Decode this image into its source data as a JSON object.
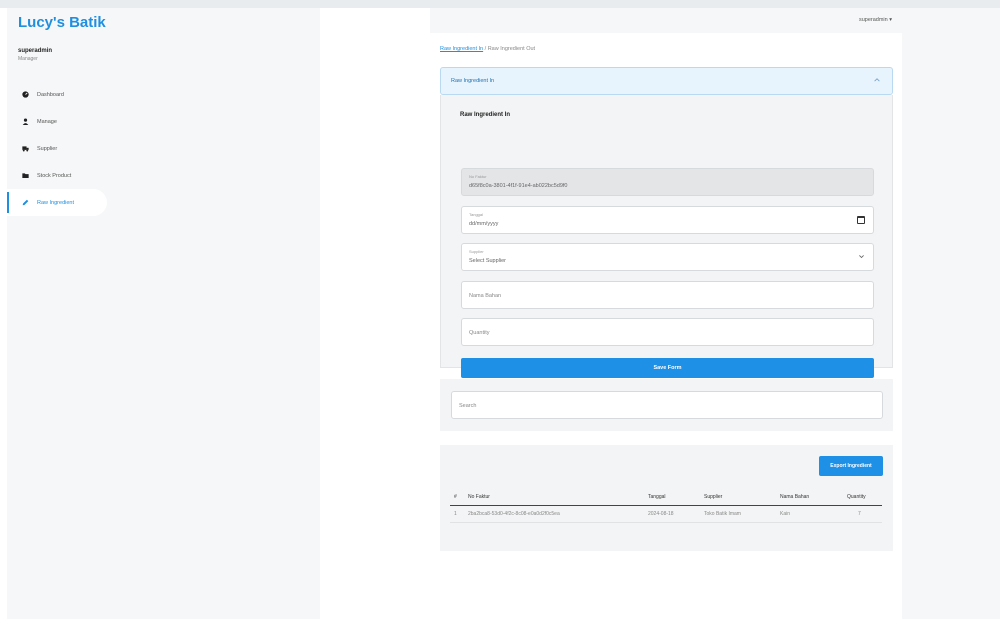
{
  "app": {
    "brand": "Lucy's Batik"
  },
  "user": {
    "name": "superadmin",
    "role": "Manager",
    "menu_label": "superadmin ▾"
  },
  "sidebar": {
    "items": [
      {
        "label": "Dashboard",
        "icon": "dashboard-icon"
      },
      {
        "label": "Manage",
        "icon": "user-icon"
      },
      {
        "label": "Supplier",
        "icon": "truck-icon"
      },
      {
        "label": "Stock Product",
        "icon": "folder-icon"
      },
      {
        "label": "Raw Ingredient",
        "icon": "edit-icon",
        "active": true
      }
    ]
  },
  "breadcrumb": {
    "link": "Raw Ingredient In",
    "separator": "/",
    "current": "Raw Ingredient Out"
  },
  "accordion": {
    "title": "Raw Ingredient In"
  },
  "form": {
    "title": "Raw Ingredient In",
    "no_faktur": {
      "label": "No Faktur",
      "value": "d65f8c0a-3801-4f1f-91e4-ab022bc5d9f0"
    },
    "tanggal": {
      "label": "Tanggal",
      "placeholder": "dd/mm/yyyy"
    },
    "supplier": {
      "label": "Supplier",
      "placeholder": "Select Supplier"
    },
    "nama_bahan": {
      "placeholder": "Nama Bahan"
    },
    "quantity": {
      "placeholder": "Quantity"
    },
    "save_label": "Save Form"
  },
  "search": {
    "placeholder": "Search"
  },
  "table": {
    "export_label": "Export Ingredient",
    "columns": [
      "#",
      "No Faktur",
      "Tanggal",
      "Supplier",
      "Nama Bahan",
      "Quantity"
    ],
    "rows": [
      [
        "1",
        "2ba2bca8-53d0-4f2c-8c08-e0a0d2f0c5ea",
        "2024-08-18",
        "Toko Batik Imam",
        "Kain",
        "7"
      ]
    ]
  }
}
